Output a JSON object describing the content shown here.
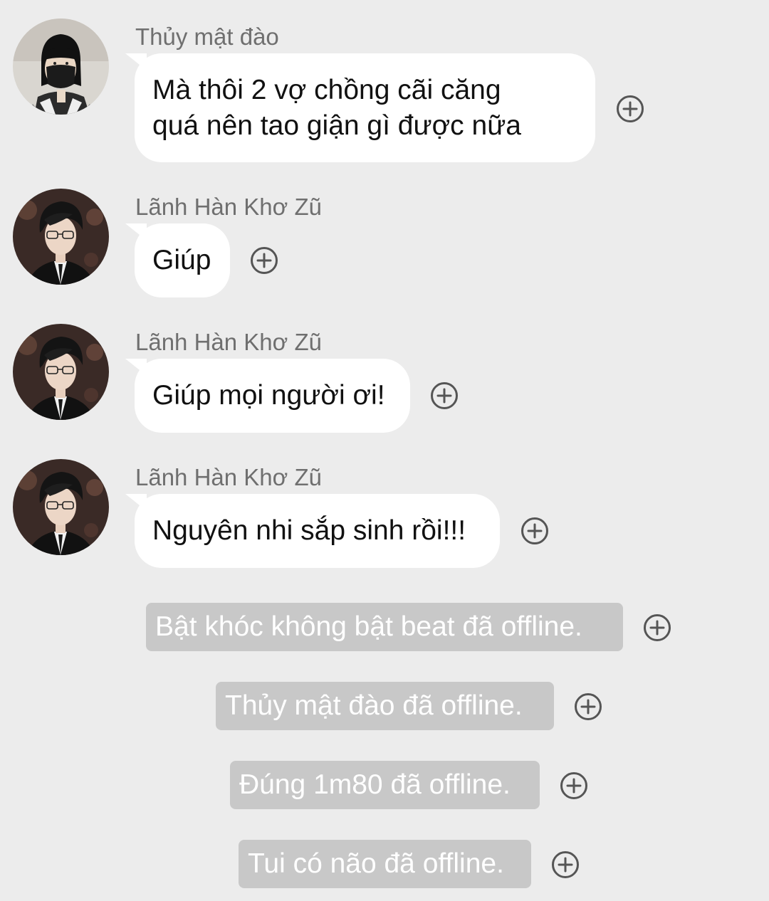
{
  "messages": [
    {
      "sender": "Thủy mật đào",
      "avatar": "avatar-woman-masked",
      "lines": [
        "Mà thôi 2 vợ chồng cãi căng",
        "quá nên tao giận gì được nữa"
      ]
    },
    {
      "sender": "Lãnh Hàn Khơ Zũ",
      "avatar": "avatar-man-glasses",
      "lines": [
        "Giúp"
      ]
    },
    {
      "sender": "Lãnh Hàn Khơ Zũ",
      "avatar": "avatar-man-glasses",
      "lines": [
        "Giúp mọi người ơi!"
      ]
    },
    {
      "sender": "Lãnh Hàn Khơ Zũ",
      "avatar": "avatar-man-glasses",
      "lines": [
        "Nguyên nhi sắp sinh rồi!!!"
      ]
    }
  ],
  "system_notices": [
    "Bật khóc không bật beat đã offline.",
    "Thủy mật đào đã offline.",
    "Đúng 1m80 đã offline.",
    "Tui có não đã offline."
  ],
  "reaction_icon": "add-reaction-icon",
  "colors": {
    "background": "#ececec",
    "bubble": "#ffffff",
    "system_notice": "#c8c8c8",
    "sender_text": "#6f6f6f",
    "icon": "#555555"
  }
}
